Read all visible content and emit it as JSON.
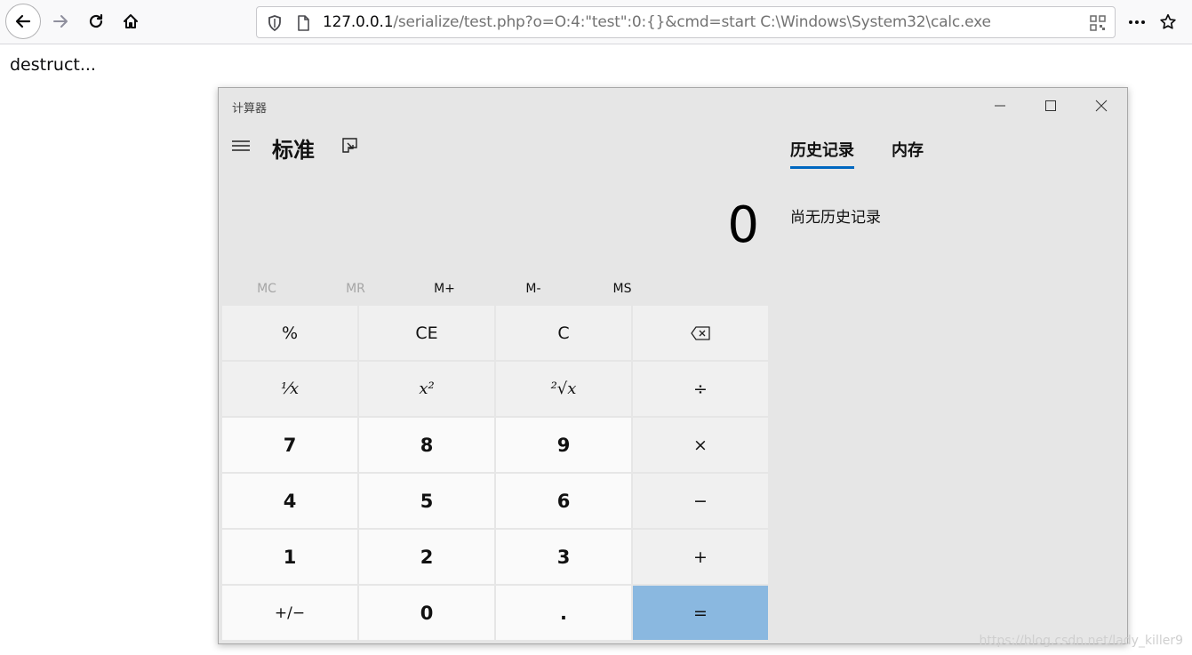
{
  "browser": {
    "url_host": "127.0.0.1",
    "url_path": "/serialize/test.php?o=O:4:\"test\":0:{}&cmd=start C:\\Windows\\System32\\calc.exe"
  },
  "page": {
    "body_text": "destruct..."
  },
  "calculator": {
    "window_title": "计算器",
    "mode_title": "标准",
    "display_value": "0",
    "tabs": [
      "历史记录",
      "内存"
    ],
    "history_empty_text": "尚无历史记录",
    "memory_buttons": [
      "MC",
      "MR",
      "M+",
      "M-",
      "MS"
    ],
    "keys": {
      "percent": "%",
      "ce": "CE",
      "clear": "C",
      "reciprocal": "⅟x",
      "square": "x²",
      "sqrt": "²√x",
      "divide": "÷",
      "seven": "7",
      "eight": "8",
      "nine": "9",
      "multiply": "×",
      "four": "4",
      "five": "5",
      "six": "6",
      "minus": "−",
      "one": "1",
      "two": "2",
      "three": "3",
      "plus": "+",
      "negate": "+/−",
      "zero": "0",
      "decimal": ".",
      "equals": "="
    },
    "accent_color": "#0067c0",
    "equals_color": "#8ab8e0"
  },
  "watermark": "https://blog.csdn.net/lady_killer9"
}
